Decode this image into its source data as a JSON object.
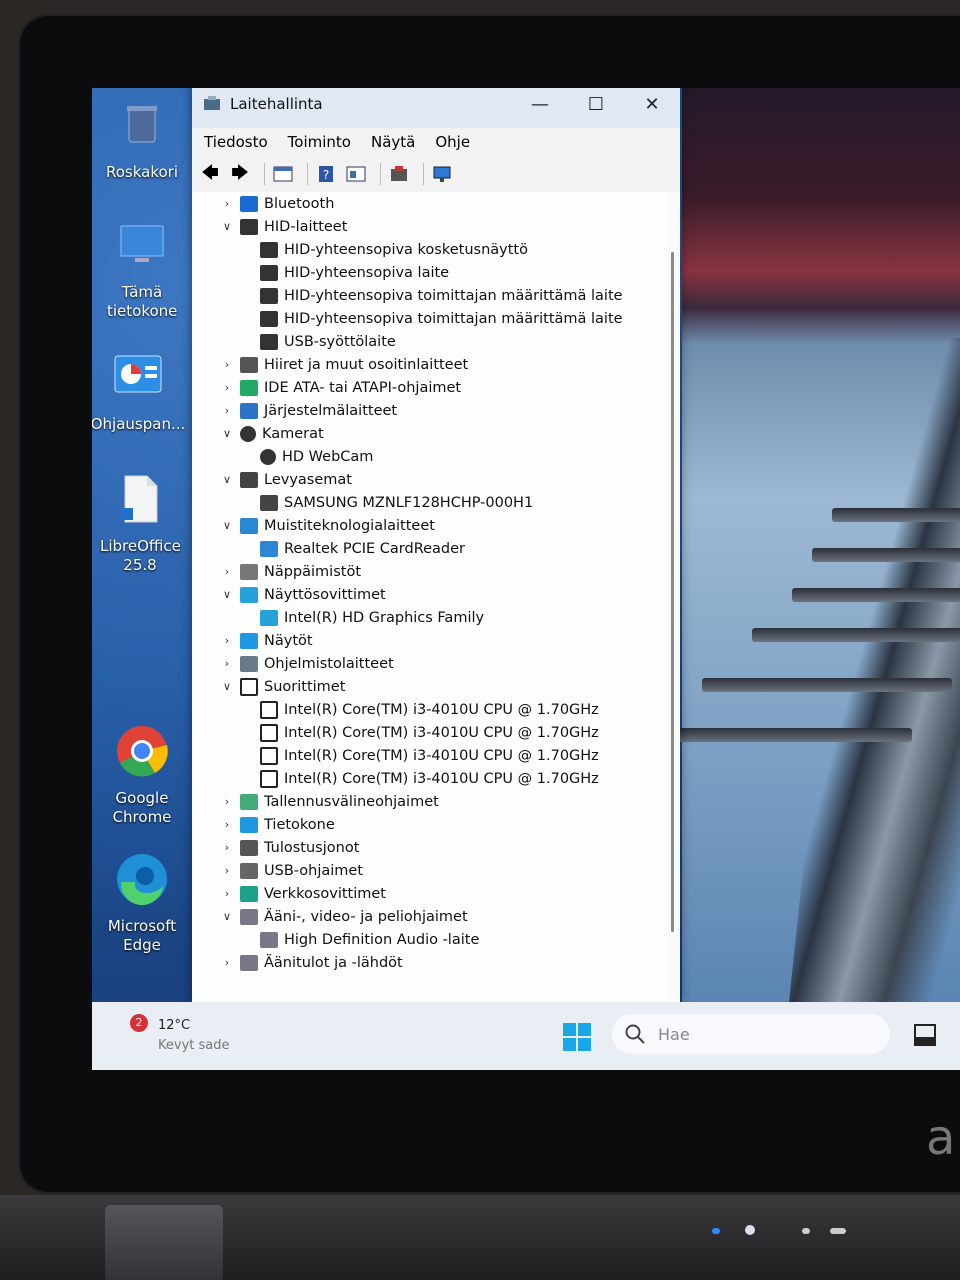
{
  "window": {
    "title": "Laitehallinta",
    "minimize": "—",
    "maximize": "☐",
    "close": "✕"
  },
  "menu": [
    "Tiedosto",
    "Toiminto",
    "Näytä",
    "Ohje"
  ],
  "desktop_icons": [
    {
      "label": "Roskakori",
      "icon": "recycle-bin-icon"
    },
    {
      "label": "Tämä tietokone",
      "icon": "computer-icon"
    },
    {
      "label": "Ohjauspan...",
      "icon": "control-panel-icon"
    },
    {
      "label": "LibreOffice 25.8",
      "icon": "libreoffice-icon"
    },
    {
      "label": "Google Chrome",
      "icon": "chrome-icon"
    },
    {
      "label": "Microsoft Edge",
      "icon": "edge-icon"
    }
  ],
  "tree": [
    {
      "label": "Bluetooth",
      "level": 0,
      "state": "collapsed",
      "icon": "bluetooth-icon"
    },
    {
      "label": "HID-laitteet",
      "level": 0,
      "state": "expanded",
      "icon": "hid-icon"
    },
    {
      "label": "HID-yhteensopiva kosketusnäyttö",
      "level": 1,
      "icon": "hid-icon"
    },
    {
      "label": "HID-yhteensopiva laite",
      "level": 1,
      "icon": "hid-icon"
    },
    {
      "label": "HID-yhteensopiva toimittajan määrittämä laite",
      "level": 1,
      "icon": "hid-icon"
    },
    {
      "label": "HID-yhteensopiva toimittajan määrittämä laite",
      "level": 1,
      "icon": "hid-icon"
    },
    {
      "label": "USB-syöttölaite",
      "level": 1,
      "icon": "hid-icon"
    },
    {
      "label": "Hiiret ja muut osoitinlaitteet",
      "level": 0,
      "state": "collapsed",
      "icon": "mouse-icon"
    },
    {
      "label": "IDE ATA- tai ATAPI-ohjaimet",
      "level": 0,
      "state": "collapsed",
      "icon": "ide-icon"
    },
    {
      "label": "Järjestelmälaitteet",
      "level": 0,
      "state": "collapsed",
      "icon": "system-icon"
    },
    {
      "label": "Kamerat",
      "level": 0,
      "state": "expanded",
      "icon": "camera-icon"
    },
    {
      "label": "HD WebCam",
      "level": 1,
      "icon": "camera-icon"
    },
    {
      "label": "Levyasemat",
      "level": 0,
      "state": "expanded",
      "icon": "disk-icon"
    },
    {
      "label": "SAMSUNG MZNLF128HCHP-000H1",
      "level": 1,
      "icon": "disk-icon"
    },
    {
      "label": "Muistiteknologialaitteet",
      "level": 0,
      "state": "expanded",
      "icon": "memory-icon"
    },
    {
      "label": "Realtek PCIE CardReader",
      "level": 1,
      "icon": "memory-icon"
    },
    {
      "label": "Näppäimistöt",
      "level": 0,
      "state": "collapsed",
      "icon": "keyboard-icon"
    },
    {
      "label": "Näyttösovittimet",
      "level": 0,
      "state": "expanded",
      "icon": "display-adapter-icon"
    },
    {
      "label": "Intel(R) HD Graphics Family",
      "level": 1,
      "icon": "display-adapter-icon"
    },
    {
      "label": "Näytöt",
      "level": 0,
      "state": "collapsed",
      "icon": "monitor-icon"
    },
    {
      "label": "Ohjelmistolaitteet",
      "level": 0,
      "state": "collapsed",
      "icon": "software-icon"
    },
    {
      "label": "Suorittimet",
      "level": 0,
      "state": "expanded",
      "icon": "cpu-icon"
    },
    {
      "label": "Intel(R) Core(TM) i3-4010U CPU @ 1.70GHz",
      "level": 1,
      "icon": "cpu-icon"
    },
    {
      "label": "Intel(R) Core(TM) i3-4010U CPU @ 1.70GHz",
      "level": 1,
      "icon": "cpu-icon"
    },
    {
      "label": "Intel(R) Core(TM) i3-4010U CPU @ 1.70GHz",
      "level": 1,
      "icon": "cpu-icon"
    },
    {
      "label": "Intel(R) Core(TM) i3-4010U CPU @ 1.70GHz",
      "level": 1,
      "icon": "cpu-icon"
    },
    {
      "label": "Tallennusvälineohjaimet",
      "level": 0,
      "state": "collapsed",
      "icon": "storage-icon"
    },
    {
      "label": "Tietokone",
      "level": 0,
      "state": "collapsed",
      "icon": "computer-icon"
    },
    {
      "label": "Tulostusjonot",
      "level": 0,
      "state": "collapsed",
      "icon": "printer-icon"
    },
    {
      "label": "USB-ohjaimet",
      "level": 0,
      "state": "collapsed",
      "icon": "usb-icon"
    },
    {
      "label": "Verkkosovittimet",
      "level": 0,
      "state": "collapsed",
      "icon": "network-icon"
    },
    {
      "label": "Ääni-, video- ja peliohjaimet",
      "level": 0,
      "state": "expanded",
      "icon": "speaker-icon"
    },
    {
      "label": "High Definition Audio -laite",
      "level": 1,
      "icon": "speaker-icon"
    },
    {
      "label": "Äänitulot ja -lähdöt",
      "level": 0,
      "state": "collapsed",
      "icon": "speaker-icon"
    }
  ],
  "taskbar": {
    "weather_badge": "2",
    "temperature": "12°C",
    "condition": "Kevyt sade",
    "search_placeholder": "Hae"
  },
  "colors": {
    "accent": "#0078d4",
    "titlebar": "#dfe8f3"
  }
}
